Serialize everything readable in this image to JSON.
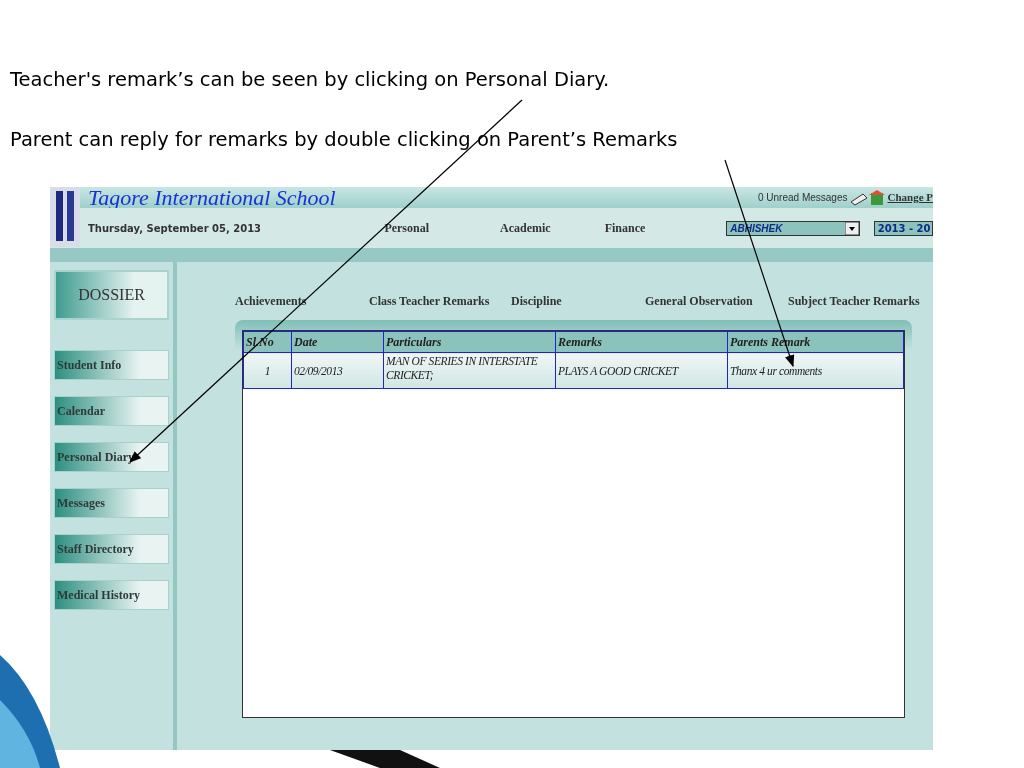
{
  "captions": [
    "Teacher's remark’s can be seen by clicking on Personal Diary.",
    "Parent can reply for remarks by double clicking on Parent’s Remarks"
  ],
  "app": {
    "school_name": "Tagore International School",
    "unread_messages": "0 Unread Messages",
    "change_link": "Change P",
    "date": "Thursday, September 05, 2013",
    "menu": [
      "Personal",
      "Academic",
      "Finance"
    ],
    "student_select": {
      "value": "ABHISHEK"
    },
    "year_select": {
      "value": "2013 - 20"
    },
    "dossier": "DOSSIER",
    "sidebar": {
      "items": [
        "Student Info",
        "Calendar",
        "Personal Diary",
        "Messages",
        "Staff Directory",
        "Medical History"
      ]
    },
    "tabs": [
      "Achievements",
      "Class Teacher Remarks",
      "Discipline",
      "General Observation",
      "Subject Teacher Remarks"
    ],
    "table": {
      "columns": [
        "Sl.No",
        "Date",
        "Particulars",
        "Remarks",
        "Parents Remark"
      ],
      "rows": [
        [
          "1",
          "02/09/2013",
          "MAN OF SERIES IN INTERSTATE CRICKET;",
          "PLAYS A GOOD CRICKET",
          "Thanx 4 ur comments"
        ]
      ]
    }
  }
}
